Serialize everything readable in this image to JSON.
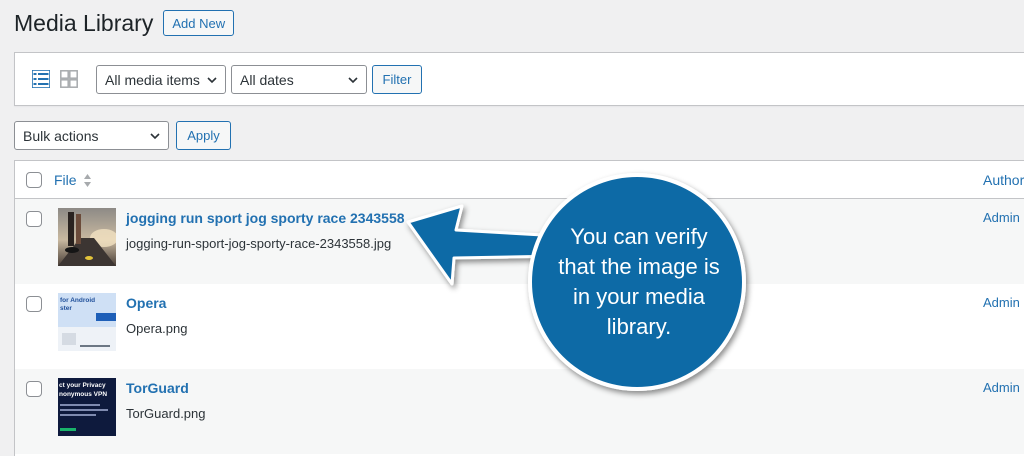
{
  "header": {
    "title": "Media Library",
    "add_new_label": "Add New"
  },
  "filters": {
    "media_type": "All media items",
    "dates": "All dates",
    "filter_label": "Filter"
  },
  "bulk": {
    "selected": "Bulk actions",
    "apply_label": "Apply"
  },
  "table": {
    "columns": {
      "file": "File",
      "author": "Author"
    },
    "rows": [
      {
        "title": "jogging run sport jog sporty race 2343558",
        "filename": "jogging-run-sport-jog-sporty-race-2343558.jpg",
        "author": "Admin"
      },
      {
        "title": "Opera",
        "filename": "Opera.png",
        "author": "Admin",
        "thumb_text_1": "for Android",
        "thumb_text_2": "ster"
      },
      {
        "title": "TorGuard",
        "filename": "TorGuard.png",
        "author": "Admin",
        "thumb_text_1": "ct your Privacy",
        "thumb_text_2": "nonymous VPN"
      }
    ]
  },
  "callout": {
    "text": "You can verify\nthat the image is\nin your media\nlibrary.",
    "color": "#0f6aa6"
  },
  "colors": {
    "accent": "#2271b1",
    "background": "#f0f0f1",
    "border": "#c3c4c7"
  }
}
